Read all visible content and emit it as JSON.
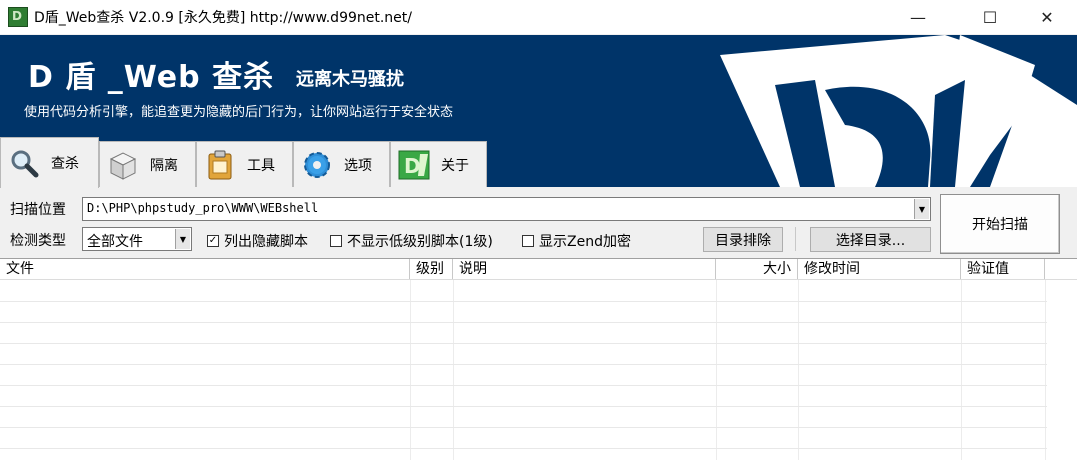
{
  "window": {
    "title": "D盾_Web查杀 V2.0.9 [永久免费] http://www.d99net.net/",
    "icon": "d-shield-app-icon",
    "controls": {
      "minimize": "—",
      "maximize": "☐",
      "close": "✕"
    }
  },
  "banner": {
    "title": "D 盾 _Web 查杀",
    "subtitle": "远离木马骚扰",
    "description": "使用代码分析引擎，能追查更为隐藏的后门行为，让你网站运行于安全状态",
    "background": "#003469"
  },
  "tabs": [
    {
      "label": "查杀",
      "icon": "magnifier-icon",
      "active": true
    },
    {
      "label": "隔离",
      "icon": "box-icon",
      "active": false
    },
    {
      "label": "工具",
      "icon": "clipboard-icon",
      "active": false
    },
    {
      "label": "选项",
      "icon": "gear-icon",
      "active": false
    },
    {
      "label": "关于",
      "icon": "d-logo-icon",
      "active": false
    }
  ],
  "scan": {
    "path_label": "扫描位置",
    "path_value": "D:\\PHP\\phpstudy_pro\\WWW\\WEBshell",
    "type_label": "检测类型",
    "type_value": "全部文件",
    "checkboxes": [
      {
        "label": "列出隐藏脚本",
        "checked": true
      },
      {
        "label": "不显示低级别脚本(1级)",
        "checked": false
      },
      {
        "label": "显示Zend加密",
        "checked": false
      }
    ],
    "exclude_button": "目录排除",
    "choose_dir_button": "选择目录...",
    "start_button": "开始扫描"
  },
  "table": {
    "columns": [
      "文件",
      "级别",
      "说明",
      "大小",
      "修改时间",
      "验证值"
    ],
    "rows": []
  }
}
